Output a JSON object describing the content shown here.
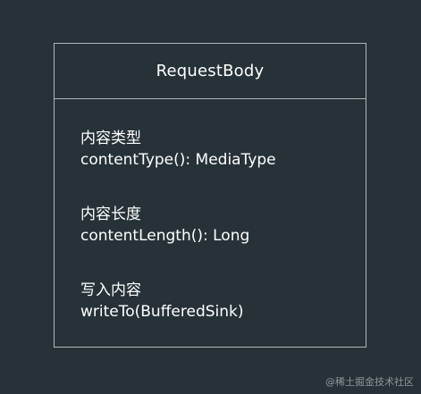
{
  "class": {
    "name": "RequestBody",
    "members": [
      {
        "label": "内容类型",
        "signature": "contentType(): MediaType"
      },
      {
        "label": "内容长度",
        "signature": "contentLength(): Long"
      },
      {
        "label": "写入内容",
        "signature": "writeTo(BufferedSink)"
      }
    ]
  },
  "watermark": "@稀土掘金技术社区"
}
